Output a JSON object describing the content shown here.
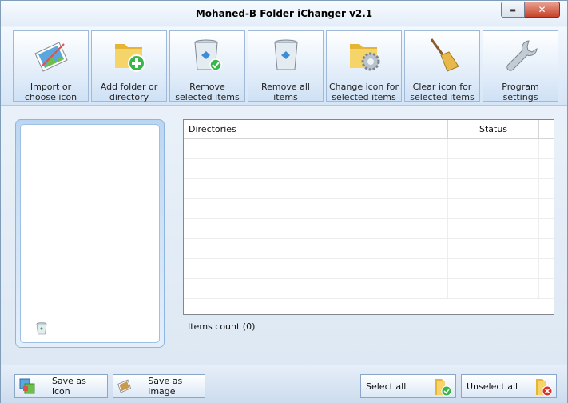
{
  "window": {
    "title": "Mohaned-B Folder iChanger v2.1",
    "minimize_glyph": "▬",
    "close_glyph": "✕"
  },
  "toolbar": {
    "items": [
      {
        "label": "Import or choose icon",
        "line1": "Import or",
        "line2": "choose icon",
        "icon": "image-import-icon"
      },
      {
        "label": "Add folder or directory",
        "line1": "Add folder or",
        "line2": "directory",
        "icon": "add-folder-icon"
      },
      {
        "label": "Remove selected items",
        "line1": "Remove",
        "line2": "selected items",
        "icon": "recycle-bin-check-icon"
      },
      {
        "label": "Remove all items",
        "line1": "",
        "line2": "Remove all items",
        "icon": "recycle-bin-icon"
      },
      {
        "label": "Change icon for selected items",
        "line1": "Change icon for",
        "line2": "selected items",
        "icon": "folder-gear-icon"
      },
      {
        "label": "Clear icon for selected items",
        "line1": "Clear icon for",
        "line2": "selected items",
        "icon": "broom-icon"
      },
      {
        "label": "Program settings",
        "line1": "Program",
        "line2": "settings",
        "icon": "wrench-icon"
      }
    ]
  },
  "grid": {
    "columns": [
      "Directories",
      "Status"
    ],
    "rows": []
  },
  "status": {
    "items_count": "Items count (0)"
  },
  "bottom": {
    "save_as_icon": "Save as icon",
    "save_as_image": "Save as image",
    "select_all": "Select all",
    "unselect_all": "Unselect all"
  },
  "colors": {
    "accent": "#9fb9d8",
    "window_bg": "#dce7f3",
    "close_red": "#c7432a",
    "folder_yellow": "#f1c84b",
    "add_green": "#39b54a"
  }
}
